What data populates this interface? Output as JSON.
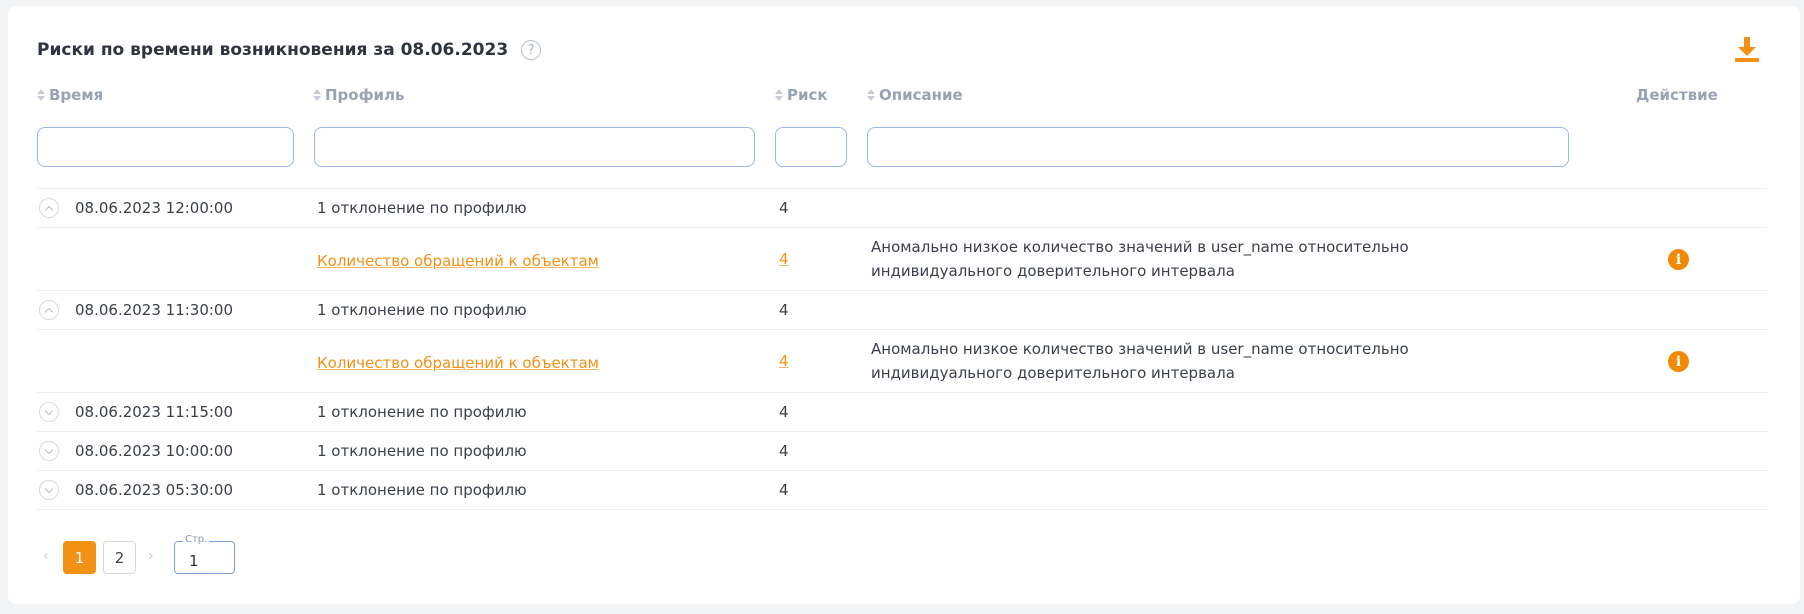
{
  "title": "Риски по времени возникновения за 08.06.2023",
  "help_icon": "?",
  "columns": {
    "time": "Время",
    "profile": "Профиль",
    "risk": "Риск",
    "description": "Описание",
    "action": "Действие"
  },
  "filters": {
    "time": "",
    "profile": "",
    "risk": "",
    "description": ""
  },
  "rows": [
    {
      "time": "08.06.2023 12:00:00",
      "profile": "1 отклонение по профилю",
      "risk": "4",
      "expanded": true,
      "detail": {
        "profile": "Количество обращений к объектам",
        "risk": "4",
        "description_line1": "Аномально низкое количество значений в user_name относительно",
        "description_line2": "индивидуального доверительного интервала",
        "action_icon": "info-icon"
      }
    },
    {
      "time": "08.06.2023 11:30:00",
      "profile": "1 отклонение по профилю",
      "risk": "4",
      "expanded": true,
      "detail": {
        "profile": "Количество обращений к объектам",
        "risk": "4",
        "description_line1": "Аномально низкое количество значений в user_name относительно",
        "description_line2": "индивидуального доверительного интервала",
        "action_icon": "info-icon"
      }
    },
    {
      "time": "08.06.2023 11:15:00",
      "profile": "1 отклонение по профилю",
      "risk": "4",
      "expanded": false
    },
    {
      "time": "08.06.2023 10:00:00",
      "profile": "1 отклонение по профилю",
      "risk": "4",
      "expanded": false
    },
    {
      "time": "08.06.2023 05:30:00",
      "profile": "1 отклонение по профилю",
      "risk": "4",
      "expanded": false
    }
  ],
  "pagination": {
    "prev": "‹",
    "next": "›",
    "pages": [
      "1",
      "2"
    ],
    "current": "1",
    "page_field_label": "Стр.",
    "page_field_value": "1"
  },
  "colors": {
    "accent": "#f39115",
    "info_icon": "#f08a05",
    "header_text": "#9aa3b4",
    "filter_border": "#9bb6e6"
  }
}
